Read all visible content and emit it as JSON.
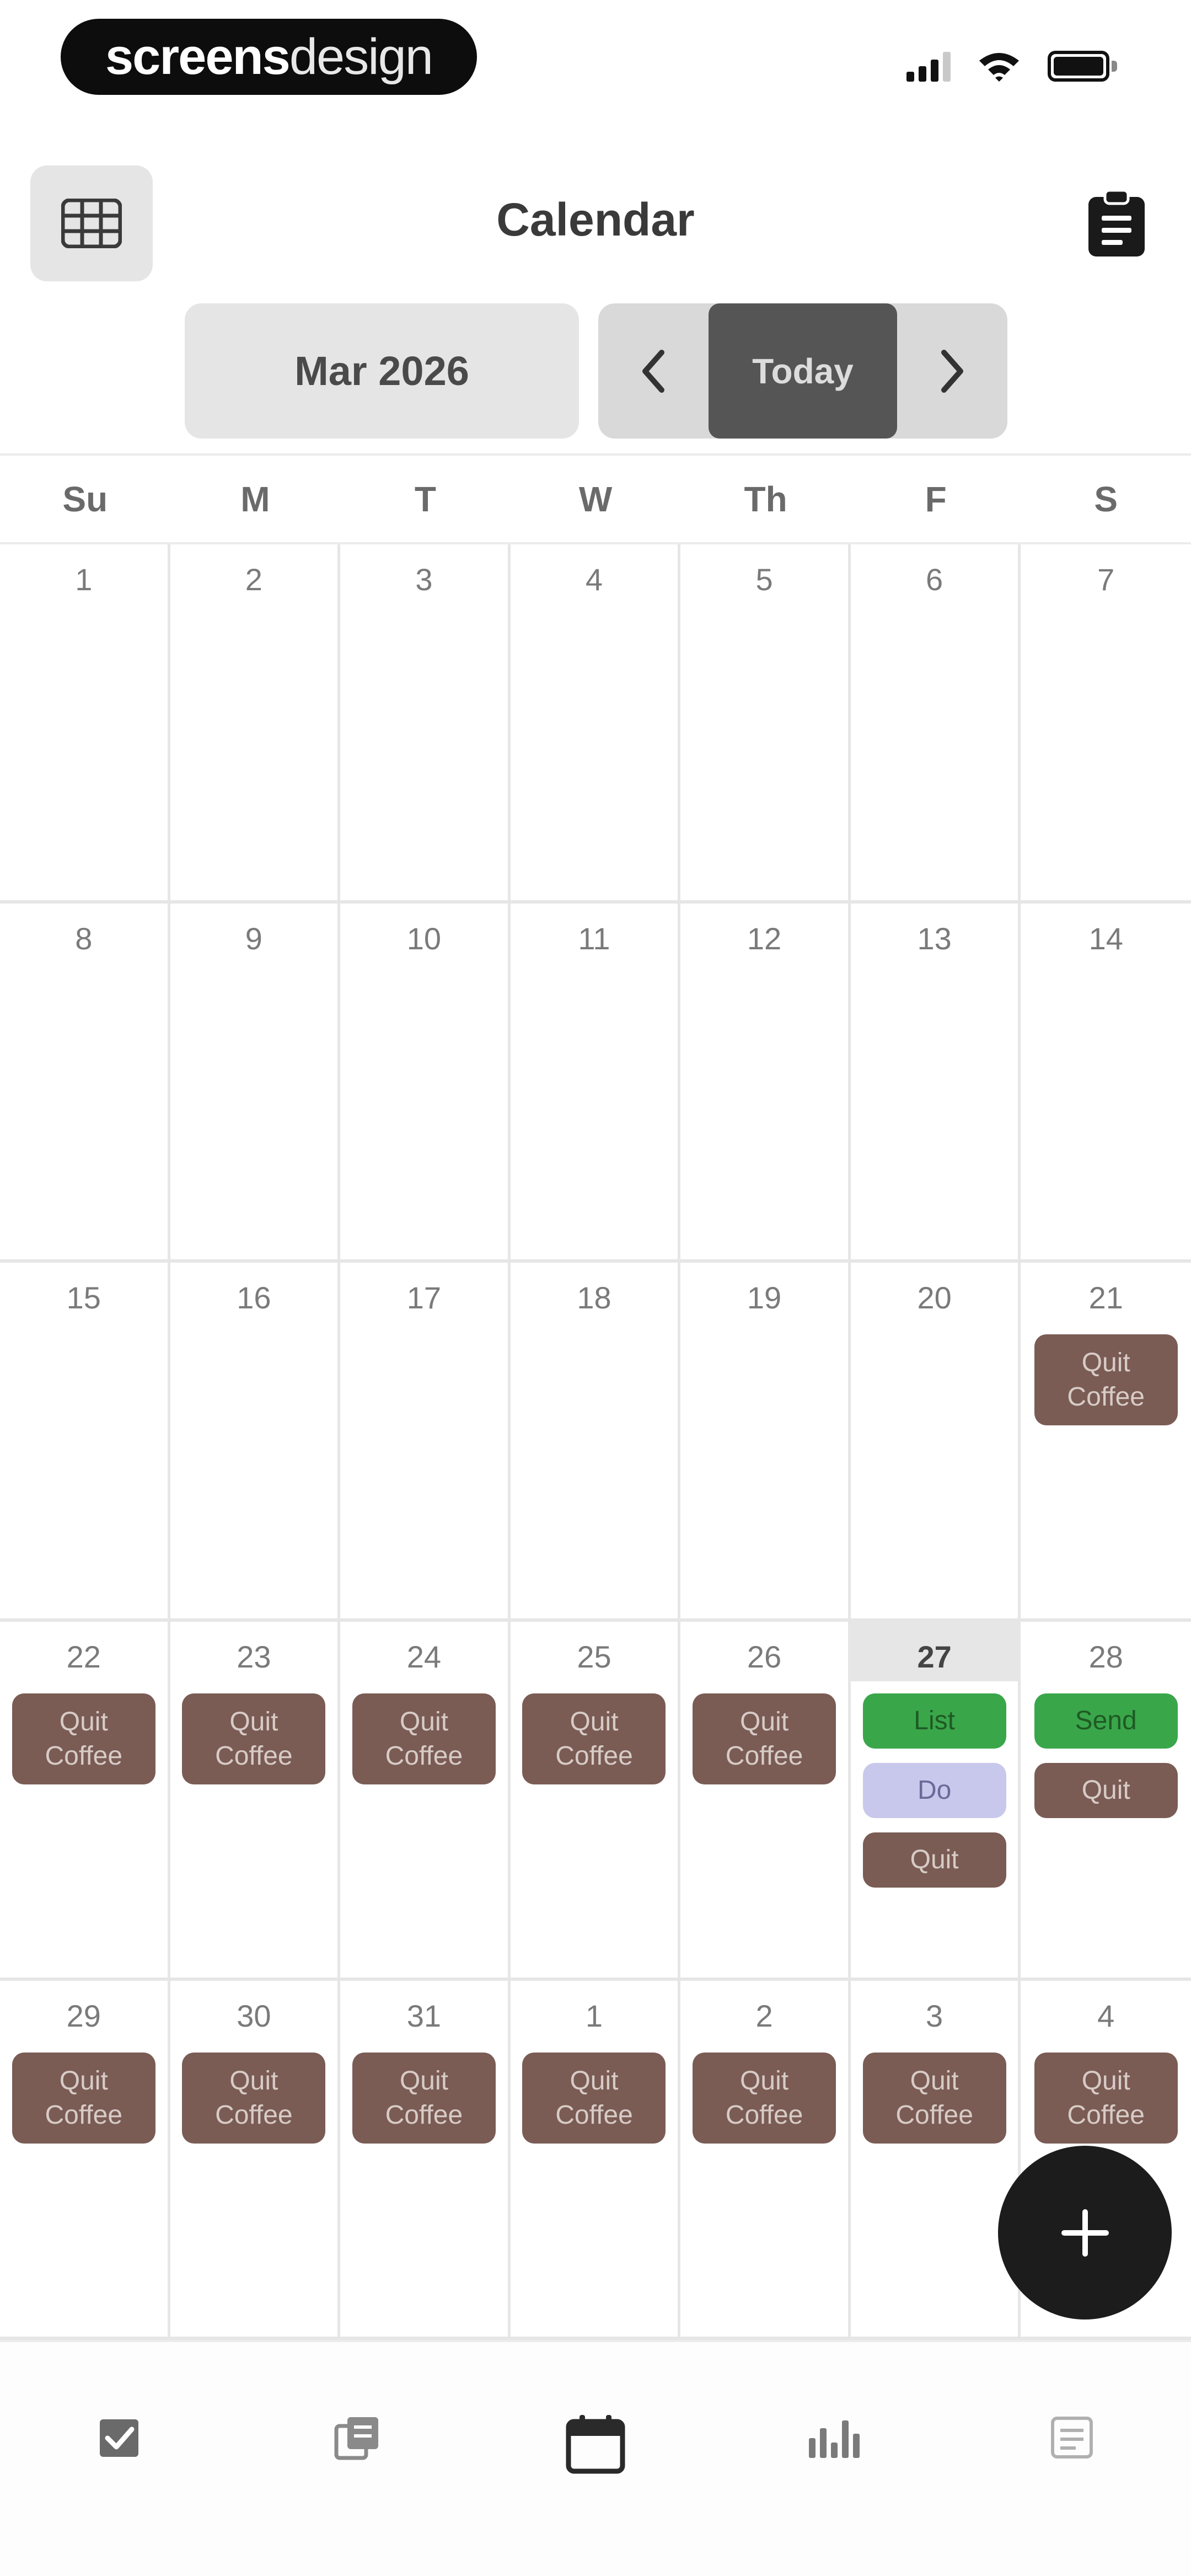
{
  "status_bar": {
    "brand_bold": "screens",
    "brand_light": "design"
  },
  "header": {
    "title": "Calendar"
  },
  "nav": {
    "month": "Mar 2026",
    "today": "Today"
  },
  "weekdays": [
    "Su",
    "M",
    "T",
    "W",
    "Th",
    "F",
    "S"
  ],
  "weeks": [
    [
      {
        "day": "1",
        "events": []
      },
      {
        "day": "2",
        "events": []
      },
      {
        "day": "3",
        "events": []
      },
      {
        "day": "4",
        "events": []
      },
      {
        "day": "5",
        "events": []
      },
      {
        "day": "6",
        "events": []
      },
      {
        "day": "7",
        "events": []
      }
    ],
    [
      {
        "day": "8",
        "events": []
      },
      {
        "day": "9",
        "events": []
      },
      {
        "day": "10",
        "events": []
      },
      {
        "day": "11",
        "events": []
      },
      {
        "day": "12",
        "events": []
      },
      {
        "day": "13",
        "events": []
      },
      {
        "day": "14",
        "events": []
      }
    ],
    [
      {
        "day": "15",
        "events": []
      },
      {
        "day": "16",
        "events": []
      },
      {
        "day": "17",
        "events": []
      },
      {
        "day": "18",
        "events": []
      },
      {
        "day": "19",
        "events": []
      },
      {
        "day": "20",
        "events": []
      },
      {
        "day": "21",
        "events": [
          {
            "label": "Quit\nCoffee",
            "color": "brown"
          }
        ]
      }
    ],
    [
      {
        "day": "22",
        "events": [
          {
            "label": "Quit\nCoffee",
            "color": "brown"
          }
        ]
      },
      {
        "day": "23",
        "events": [
          {
            "label": "Quit\nCoffee",
            "color": "brown"
          }
        ]
      },
      {
        "day": "24",
        "events": [
          {
            "label": "Quit\nCoffee",
            "color": "brown"
          }
        ]
      },
      {
        "day": "25",
        "events": [
          {
            "label": "Quit\nCoffee",
            "color": "brown"
          }
        ]
      },
      {
        "day": "26",
        "events": [
          {
            "label": "Quit\nCoffee",
            "color": "brown"
          }
        ]
      },
      {
        "day": "27",
        "today": true,
        "events": [
          {
            "label": "List",
            "color": "green"
          },
          {
            "label": "Do",
            "color": "lav"
          },
          {
            "label": "Quit",
            "color": "brown",
            "single": true
          }
        ]
      },
      {
        "day": "28",
        "events": [
          {
            "label": "Send",
            "color": "green"
          },
          {
            "label": "Quit",
            "color": "brown",
            "single": true
          }
        ]
      }
    ],
    [
      {
        "day": "29",
        "events": [
          {
            "label": "Quit\nCoffee",
            "color": "brown"
          }
        ]
      },
      {
        "day": "30",
        "events": [
          {
            "label": "Quit\nCoffee",
            "color": "brown"
          }
        ]
      },
      {
        "day": "31",
        "events": [
          {
            "label": "Quit\nCoffee",
            "color": "brown"
          }
        ]
      },
      {
        "day": "1",
        "events": [
          {
            "label": "Quit\nCoffee",
            "color": "brown"
          }
        ]
      },
      {
        "day": "2",
        "events": [
          {
            "label": "Quit\nCoffee",
            "color": "brown"
          }
        ]
      },
      {
        "day": "3",
        "events": [
          {
            "label": "Quit\nCoffee",
            "color": "brown"
          }
        ]
      },
      {
        "day": "4",
        "events": [
          {
            "label": "Quit\nCoffee",
            "color": "brown"
          }
        ]
      }
    ]
  ],
  "tabs": [
    {
      "icon": "checkbox-icon",
      "name": "tab-tasks"
    },
    {
      "icon": "notes-icon",
      "name": "tab-notes"
    },
    {
      "icon": "calendar-icon",
      "name": "tab-calendar",
      "active": true
    },
    {
      "icon": "stats-icon",
      "name": "tab-stats"
    },
    {
      "icon": "list-icon",
      "name": "tab-list"
    }
  ],
  "colors": {
    "event_brown": "#7a5c55",
    "event_green": "#3aa64a",
    "event_lavender": "#c8c8ec",
    "today_button": "#555555",
    "fab": "#1c1c1c"
  }
}
